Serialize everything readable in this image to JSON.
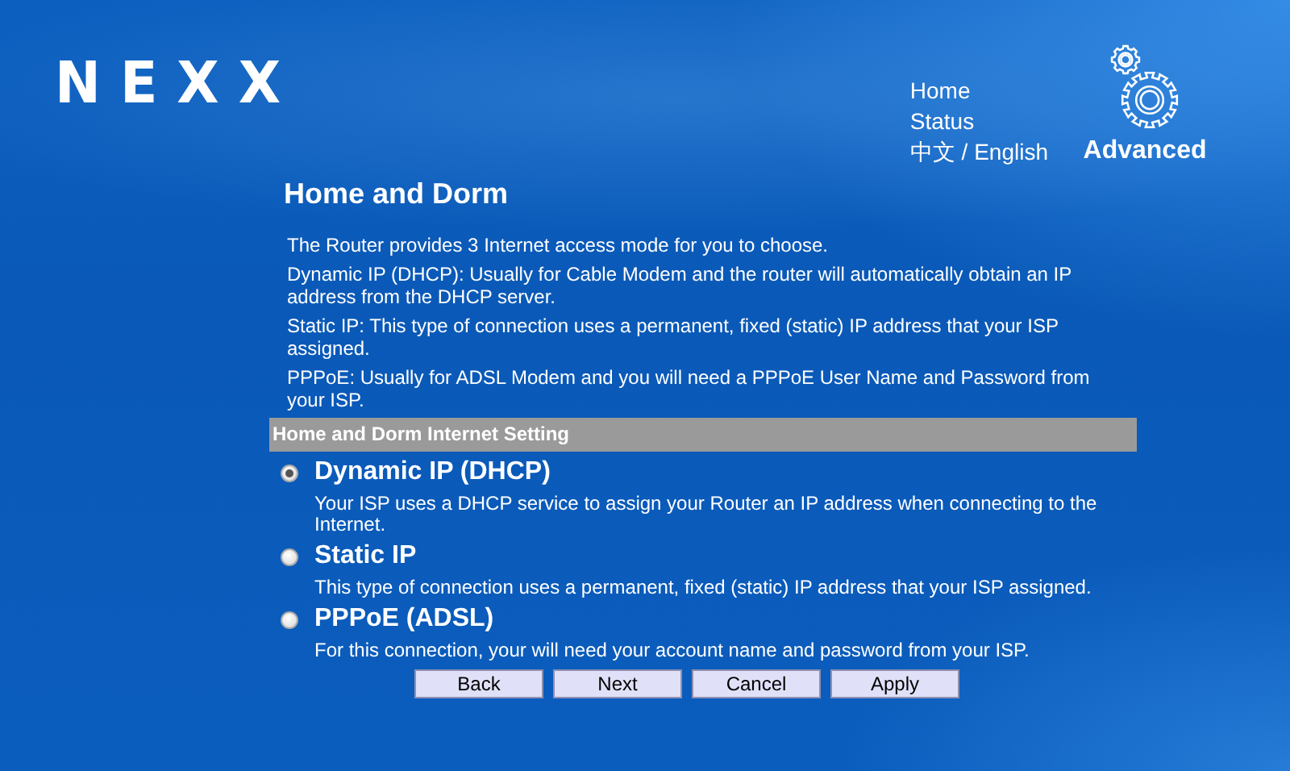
{
  "logo": "NEXX",
  "nav": [
    "Home",
    "Status",
    "中文 / English"
  ],
  "advanced": {
    "label": "Advanced"
  },
  "title": "Home and Dorm",
  "intro": [
    "The Router provides 3 Internet access mode for you to choose.",
    "Dynamic IP (DHCP): Usually for Cable Modem and the router will automatically obtain an IP address from the DHCP server.",
    "Static IP: This type of connection uses a permanent, fixed (static) IP address that your ISP assigned.",
    "PPPoE: Usually for ADSL Modem and you will need a PPPoE User Name and Password from your ISP."
  ],
  "section_header": "Home and Dorm Internet Setting",
  "options": [
    {
      "label": "Dynamic IP (DHCP)",
      "description": "Your ISP uses a DHCP service to assign your Router an IP address when connecting to the Internet.",
      "selected": true
    },
    {
      "label": "Static IP",
      "description": "This type of connection uses a permanent, fixed (static) IP address that your ISP assigned.",
      "selected": false
    },
    {
      "label": "PPPoE (ADSL)",
      "description": "For this connection, your will need your account name and password from your ISP.",
      "selected": false
    }
  ],
  "buttons": [
    "Back",
    "Next",
    "Cancel",
    "Apply"
  ]
}
